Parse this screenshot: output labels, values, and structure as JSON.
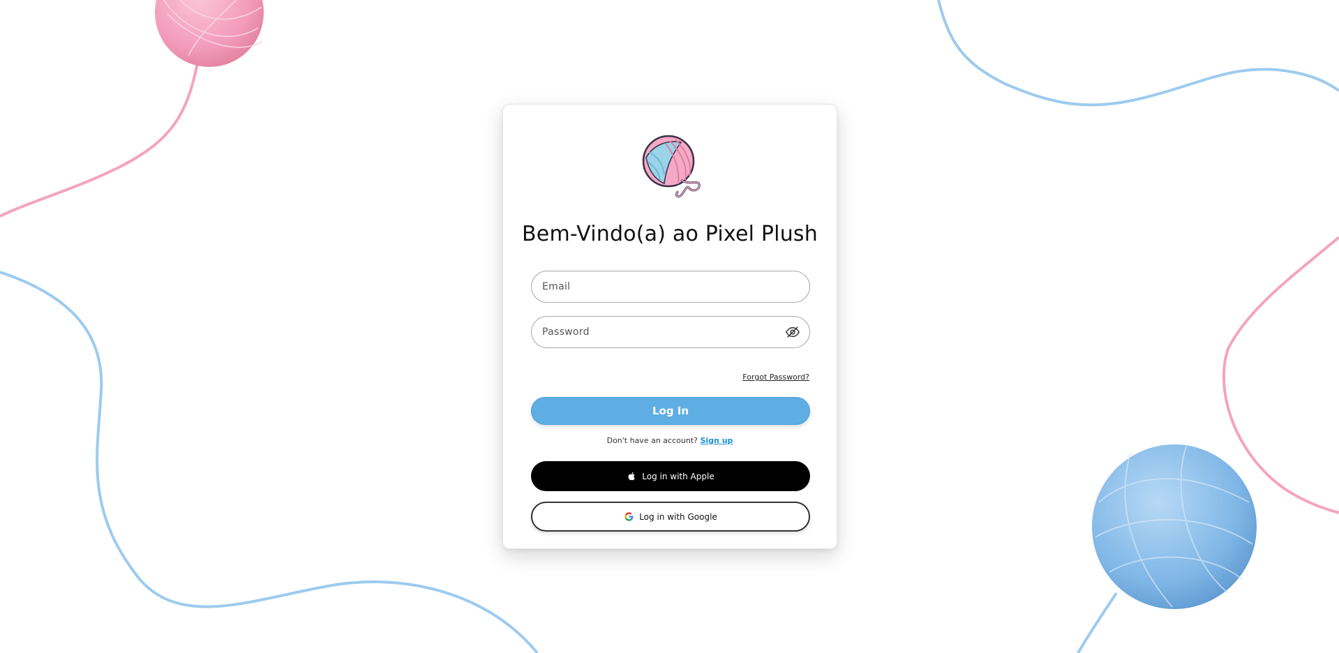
{
  "page": {
    "title": "Bem-Vindo(a) ao Pixel Plush"
  },
  "login_form": {
    "email_placeholder": "Email",
    "password_placeholder": "Password",
    "forgot_password_label": "Forgot Password?",
    "login_button_label": "Log In",
    "signup_prompt": "Don't have an account?",
    "signup_link_label": "Sign up",
    "apple_button_label": "Log in with Apple",
    "google_button_label": "Log in with Google"
  },
  "icons": {
    "logo": "yarn-ball-logo",
    "password_toggle": "eye-off-icon",
    "apple": "apple-icon",
    "google": "google-icon"
  },
  "colors": {
    "primary_button": "#5eaee3",
    "link": "#1a8fd6",
    "apple_button": "#000000",
    "yarn_pink": "#f4a9c4",
    "yarn_blue": "#8fc3ec"
  }
}
